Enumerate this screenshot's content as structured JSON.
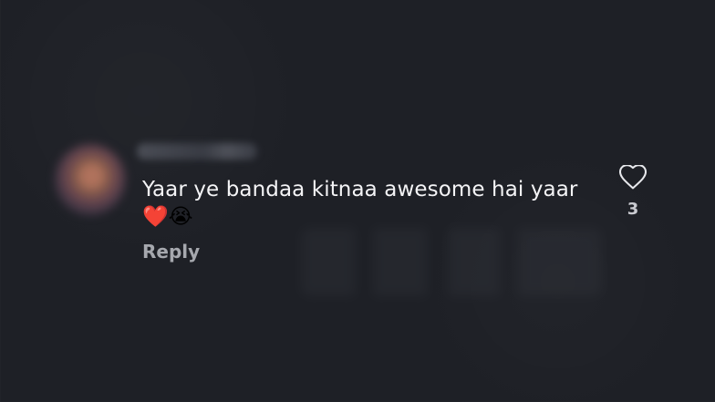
{
  "comment": {
    "text": "Yaar ye bandaa kitnaa awesome hai yaar",
    "emojis": "❤️😭",
    "reply_label": "Reply",
    "like_count": "3",
    "icons": {
      "like": "heart-icon"
    }
  }
}
